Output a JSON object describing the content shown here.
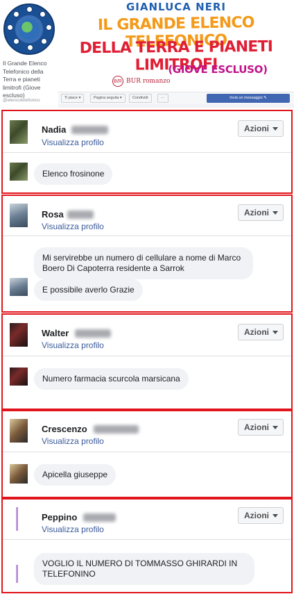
{
  "page": {
    "name": "Il Grande Elenco Telefonico della Terra e pianeti limitrofi (Giove escluso)",
    "handle": "@elencotelefonico"
  },
  "cover": {
    "author": "GIANLUCA NERI",
    "title_line1": "IL GRANDE ELENCO TELEFONICO",
    "title_line2": "DELLA TERRA E PIANETI LIMITROFI",
    "title_line3": "(GIOVE ESCLUSO)",
    "publisher_mark": "B/R",
    "publisher": "BUR romanzo"
  },
  "action_bar": {
    "like": "Ti piace ▾",
    "follow": "Pagina seguita ▾",
    "share": "Condividi",
    "more": "···",
    "message": "Invia un messaggio"
  },
  "common": {
    "profile_link": "Visualizza profilo",
    "actions_label": "Azioni"
  },
  "cards": [
    {
      "first_name": "Nadia",
      "messages": [
        "Elenco frosinone"
      ]
    },
    {
      "first_name": "Rosa",
      "messages": [
        "Mi servirebbe un numero di cellulare a nome di Marco Boero Di Capoterra residente a Sarrok",
        "E possibile averlo Grazie"
      ]
    },
    {
      "first_name": "Walter",
      "messages": [
        "Numero farmacia scurcola marsicana"
      ]
    },
    {
      "first_name": "Crescenzo",
      "messages": [
        "Apicella giuseppe"
      ]
    },
    {
      "first_name": "Peppino",
      "messages": [
        "VOGLIO IL NUMERO DI TOMMASSO GHIRARDI IN TELEFONINO"
      ]
    }
  ],
  "colors": {
    "card_border": "#e2141b",
    "link": "#385898",
    "bubble_bg": "#f0f2f5",
    "facebook_blue": "#4267b2"
  }
}
